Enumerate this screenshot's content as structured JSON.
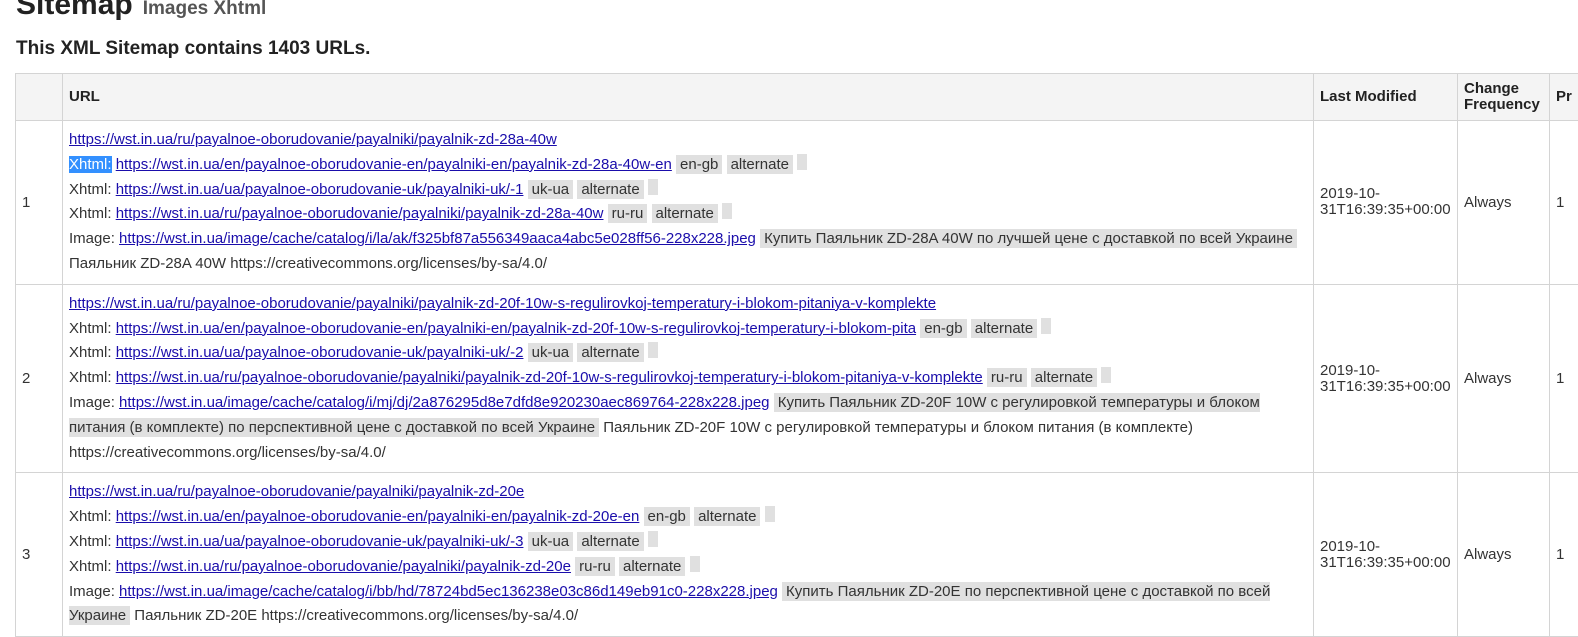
{
  "header": {
    "title": "Sitemap",
    "subtitle": "Images Xhtml",
    "summary": "This XML Sitemap contains 1403 URLs."
  },
  "table": {
    "columns": [
      "",
      "URL",
      "Last Modified",
      "Change Frequency",
      "Pr"
    ],
    "rows": [
      {
        "index": "1",
        "url": "https://wst.in.ua/ru/payalnoe-oborudovanie/payalniki/payalnik-zd-28a-40w",
        "xhtml": [
          {
            "label": "Xhtml:",
            "href": "https://wst.in.ua/en/payalnoe-oborudovanie-en/payalniki-en/payalnik-zd-28a-40w-en",
            "lang": "en-gb",
            "rel": "alternate"
          },
          {
            "label": "Xhtml:",
            "href": "https://wst.in.ua/ua/payalnoe-oborudovanie-uk/payalniki-uk/-1",
            "lang": "uk-ua",
            "rel": "alternate"
          },
          {
            "label": "Xhtml:",
            "href": "https://wst.in.ua/ru/payalnoe-oborudovanie/payalniki/payalnik-zd-28a-40w",
            "lang": "ru-ru",
            "rel": "alternate"
          }
        ],
        "image": {
          "label": "Image:",
          "href": "https://wst.in.ua/image/cache/catalog/i/la/ak/f325bf87a556349aaca4abc5e028ff56-228x228.jpeg",
          "caption": "Купить Паяльник ZD-28A 40W по лучшей цене с доставкой по всей Украине",
          "title": "Паяльник ZD-28A 40W",
          "license": "https://creativecommons.org/licenses/by-sa/4.0/"
        },
        "lastmod_date": "2019-10-",
        "lastmod_time": "31T16:39:35+00:00",
        "changefreq": "Always",
        "priority": "1"
      },
      {
        "index": "2",
        "url": "https://wst.in.ua/ru/payalnoe-oborudovanie/payalniki/payalnik-zd-20f-10w-s-regulirovkoj-temperatury-i-blokom-pitaniya-v-komplekte",
        "xhtml": [
          {
            "label": "Xhtml:",
            "href": "https://wst.in.ua/en/payalnoe-oborudovanie-en/payalniki-en/payalnik-zd-20f-10w-s-regulirovkoj-temperatury-i-blokom-pita",
            "lang": "en-gb",
            "rel": "alternate"
          },
          {
            "label": "Xhtml:",
            "href": "https://wst.in.ua/ua/payalnoe-oborudovanie-uk/payalniki-uk/-2",
            "lang": "uk-ua",
            "rel": "alternate"
          },
          {
            "label": "Xhtml:",
            "href": "https://wst.in.ua/ru/payalnoe-oborudovanie/payalniki/payalnik-zd-20f-10w-s-regulirovkoj-temperatury-i-blokom-pitaniya-v-komplekte",
            "lang": "ru-ru",
            "rel": "alternate"
          }
        ],
        "image": {
          "label": "Image:",
          "href": "https://wst.in.ua/image/cache/catalog/i/mj/dj/2a876295d8e7dfd8e920230aec869764-228x228.jpeg",
          "caption": "Купить Паяльник ZD-20F 10W с регулировкой температуры и блоком питания (в комплекте) по перспективной цене с доставкой по всей Украине",
          "title": "Паяльник ZD-20F 10W с регулировкой температуры и блоком питания (в комплекте)",
          "license": "https://creativecommons.org/licenses/by-sa/4.0/"
        },
        "lastmod_date": "2019-10-",
        "lastmod_time": "31T16:39:35+00:00",
        "changefreq": "Always",
        "priority": "1"
      },
      {
        "index": "3",
        "url": "https://wst.in.ua/ru/payalnoe-oborudovanie/payalniki/payalnik-zd-20e",
        "xhtml": [
          {
            "label": "Xhtml:",
            "href": "https://wst.in.ua/en/payalnoe-oborudovanie-en/payalniki-en/payalnik-zd-20e-en",
            "lang": "en-gb",
            "rel": "alternate"
          },
          {
            "label": "Xhtml:",
            "href": "https://wst.in.ua/ua/payalnoe-oborudovanie-uk/payalniki-uk/-3",
            "lang": "uk-ua",
            "rel": "alternate"
          },
          {
            "label": "Xhtml:",
            "href": "https://wst.in.ua/ru/payalnoe-oborudovanie/payalniki/payalnik-zd-20e",
            "lang": "ru-ru",
            "rel": "alternate"
          }
        ],
        "image": {
          "label": "Image:",
          "href": "https://wst.in.ua/image/cache/catalog/i/bb/hd/78724bd5ec136238e03c86d149eb91c0-228x228.jpeg",
          "caption": "Купить Паяльник ZD-20E по перспективной цене с доставкой по всей Украине",
          "title": "Паяльник ZD-20E",
          "license": "https://creativecommons.org/licenses/by-sa/4.0/"
        },
        "lastmod_date": "2019-10-",
        "lastmod_time": "31T16:39:35+00:00",
        "changefreq": "Always",
        "priority": "1"
      }
    ]
  }
}
